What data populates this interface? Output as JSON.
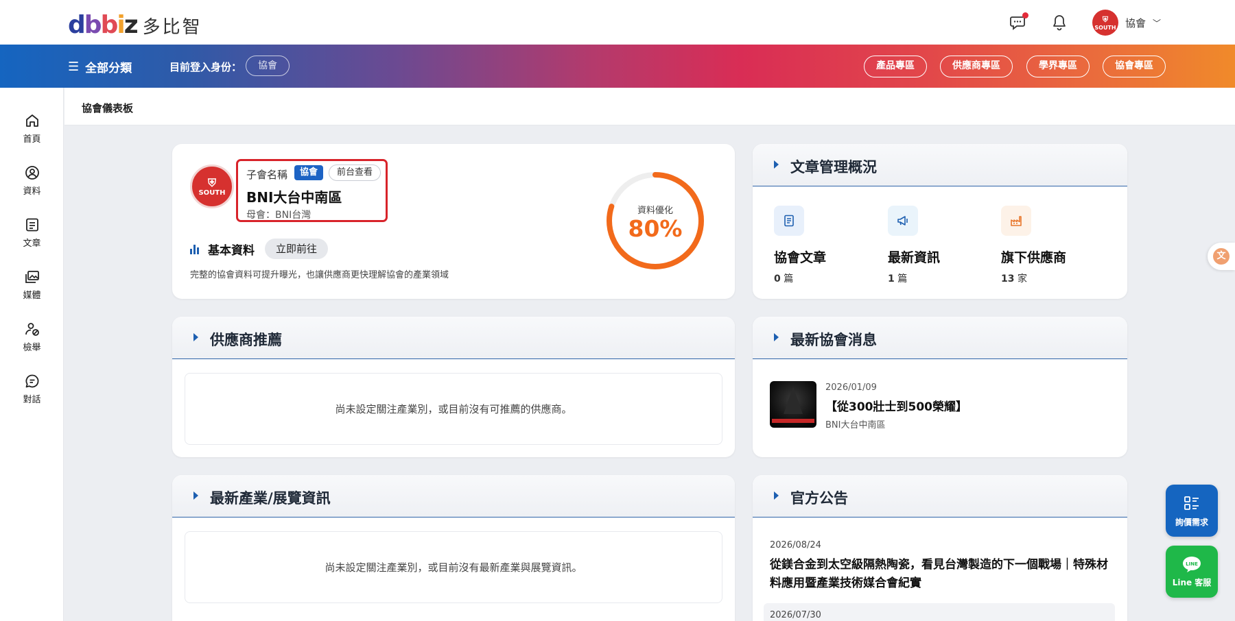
{
  "header": {
    "logo_mark": "dbbiz",
    "logo_text": "多比智",
    "user_name": "協會",
    "avatar_text": "SOUTH"
  },
  "navbar": {
    "menu_label": "全部分類",
    "login_as_label": "目前登入身份：",
    "role": "協會",
    "zones": [
      "產品專區",
      "供應商專區",
      "學界專區",
      "協會專區"
    ]
  },
  "sidebar": {
    "items": [
      {
        "label": "首頁",
        "icon": "home-icon"
      },
      {
        "label": "資料",
        "icon": "profile-icon"
      },
      {
        "label": "文章",
        "icon": "article-icon"
      },
      {
        "label": "媒體",
        "icon": "media-icon"
      },
      {
        "label": "檢舉",
        "icon": "report-icon"
      },
      {
        "label": "對話",
        "icon": "chat-icon"
      }
    ]
  },
  "breadcrumb": "協會儀表板",
  "profile": {
    "sub_label": "子會名稱",
    "type_tag": "協會",
    "frontend_btn": "前台查看",
    "name": "BNI大台中南區",
    "parent": "母會：BNI台灣",
    "avatar_text": "SOUTH",
    "basic_title": "基本資料",
    "go_btn": "立即前往",
    "desc": "完整的協會資料可提升曝光，也讓供應商更快理解協會的產業領域",
    "gauge_label": "資料優化",
    "gauge_value": "80%",
    "gauge_fraction": 0.8,
    "gauge_color": "#f26a1b"
  },
  "articles": {
    "title": "文章管理概況",
    "stats": [
      {
        "title": "協會文章",
        "count": "0",
        "unit": "篇",
        "icon": "document-icon"
      },
      {
        "title": "最新資訊",
        "count": "1",
        "unit": "篇",
        "icon": "megaphone-icon"
      },
      {
        "title": "旗下供應商",
        "count": "13",
        "unit": "家",
        "icon": "factory-icon"
      }
    ]
  },
  "suppliers": {
    "title": "供應商推薦",
    "empty": "尚未設定關注產業別，或目前沒有可推薦的供應商。"
  },
  "news": {
    "title": "最新協會消息",
    "date": "2026/01/09",
    "headline": "【從300壯士到500榮耀】",
    "source": "BNI大台中南區"
  },
  "industry": {
    "title": "最新產業/展覽資訊",
    "empty": "尚未設定關注產業別，或目前沒有最新產業與展覽資訊。"
  },
  "announcements": {
    "title": "官方公告",
    "items": [
      {
        "date": "2026/08/24",
        "title": "從鎂合金到太空級隔熱陶瓷，看見台灣製造的下一個戰場｜特殊材料應用暨產業技術媒合會紀實"
      },
      {
        "date": "2026/07/30",
        "title": ""
      }
    ]
  },
  "floating": {
    "quote_label": "詢價需求",
    "line_label": "Line 客服",
    "line_logo": "LINE"
  }
}
